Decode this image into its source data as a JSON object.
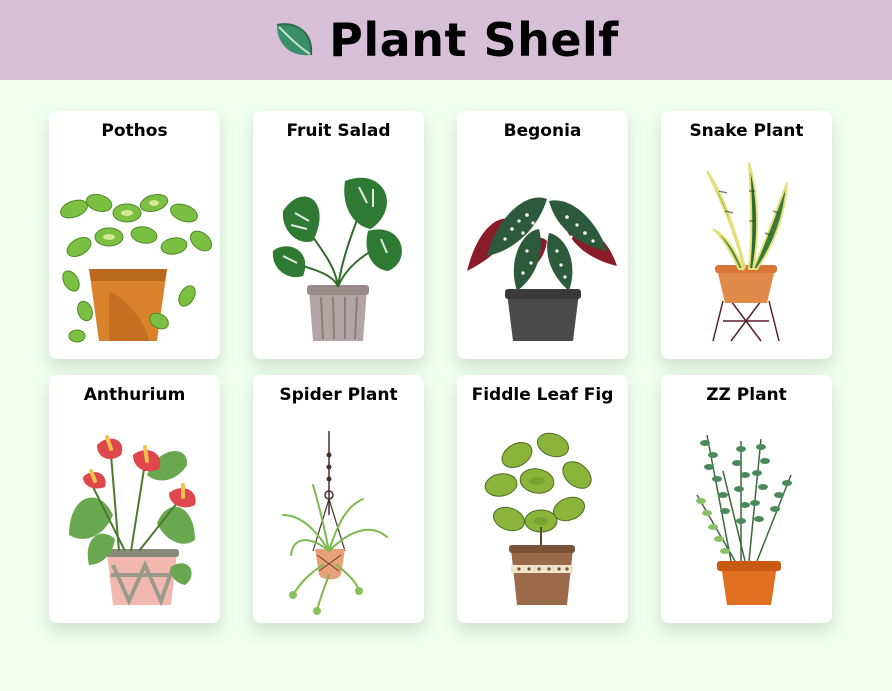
{
  "header": {
    "title": "Plant Shelf",
    "icon": "leaf-icon",
    "background": "#d8bfd8"
  },
  "page": {
    "background": "#f0fff0"
  },
  "plants": [
    {
      "name": "Pothos",
      "icon": "pothos-illustration"
    },
    {
      "name": "Fruit Salad",
      "icon": "monstera-illustration"
    },
    {
      "name": "Begonia",
      "icon": "begonia-illustration"
    },
    {
      "name": "Snake Plant",
      "icon": "snake-plant-illustration"
    },
    {
      "name": "Anthurium",
      "icon": "anthurium-illustration"
    },
    {
      "name": "Spider Plant",
      "icon": "spider-plant-illustration"
    },
    {
      "name": "Fiddle Leaf Fig",
      "icon": "fiddle-leaf-fig-illustration"
    },
    {
      "name": "ZZ Plant",
      "icon": "zz-plant-illustration"
    }
  ]
}
